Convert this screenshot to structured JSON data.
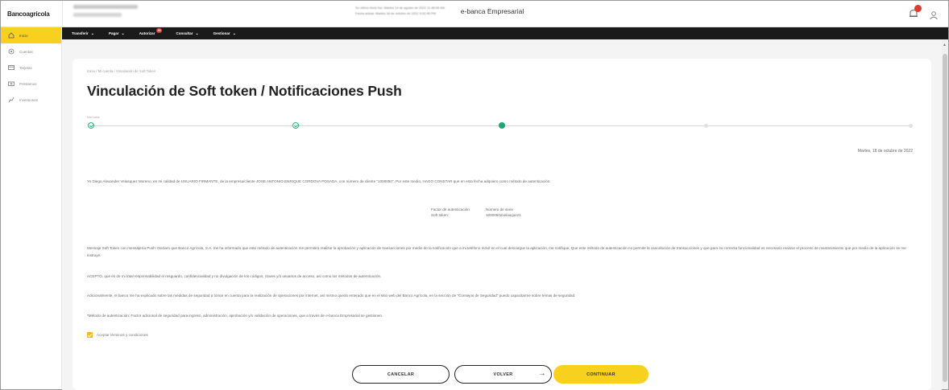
{
  "header": {
    "logo": "Bancoagrícola",
    "ebanca_label": "e-banca Empresarial",
    "session_line1": "Su último inicio fue: Martes 14 de agosto de 2022 11:48:06 AM",
    "session_line2": "Fecha actual: Martes 18 de octubre de 2022 9:02:46 PM",
    "notification_count": "1"
  },
  "menu": {
    "items": [
      {
        "label": "Transferir"
      },
      {
        "label": "Pagar"
      },
      {
        "label": "Autorizar",
        "badge": "25"
      },
      {
        "label": "Consultar"
      },
      {
        "label": "Gestionar"
      }
    ]
  },
  "sidebar": {
    "items": [
      {
        "label": "Inicio",
        "icon": "home-icon"
      },
      {
        "label": "Cuentas",
        "icon": "account-icon"
      },
      {
        "label": "Tarjetas",
        "icon": "card-icon"
      },
      {
        "label": "Préstamos",
        "icon": "loan-icon"
      },
      {
        "label": "Inversiones",
        "icon": "investment-icon"
      }
    ]
  },
  "breadcrumb": "Inicio  /  Mi cuenta  /  Vinculación de Soft Token",
  "title": "Vinculación de Soft token / Notificaciones Push",
  "stepper": {
    "label": "Mis Datos",
    "total_steps": 5,
    "current_step": 3
  },
  "date": "Martes, 18 de octubre de 2022",
  "paragraphs": {
    "intro": "Yo Diego Alexander Velasquez Moreno, en mi calidad de USUARIO FIRMANTE, de la empresa/cliente JOSE ANTONIO ENRIQUE CORDOVA POSADA, con número de cliente \"1000050\". Por este medio, HAGO CONSTAR que en esta fecha adquiero como método de autenticación:",
    "softtoken": "Mensaje Soft Token con mensajería Push: Declaro que Banco Agrícola, S.A. me ha informado que este método de autenticación me permitirá realizar la aprobación y aplicación de transacciones por medio de la notificación que a mi teléfono móvil en el cual descargue la aplicación, me notifique. Que este método de autenticación no permite la cancelación de transacciones y que para su correcta funcionalidad es necesario realizar el proceso de mantenimiento que por medio de la aplicación se me instruye.",
    "accept": "ACEPTO, que es de mi total responsabilidad el resguardo, confidencialidad y no divulgación de los códigos, claves y/o usuarios de acceso, así como los métodos de autenticación.",
    "additional": "Adicionalmente, el banco me ha explicado sobre las medidas de seguridad a tomar en cuenta para la realización de operaciones por internet, así mismo quedo enterado que en el sitio web del Banco Agrícola, en la sección de \"Consejos de Seguridad\" puedo capacitarme sobre temas de seguridad.",
    "definition": "*Método de autenticación: Factor adicional de seguridad para ingreso, administración, aprobación y/o validación de operaciones, que a través de e-banca Empresarial se gestionen."
  },
  "auth_table": {
    "col1_header": "Factor de autenticación",
    "col2_header": "Número de serie",
    "col1_value": "Soft token:",
    "col2_value": "1000050dvelasquez1"
  },
  "checkbox_label": "Aceptar términos y condiciones",
  "checkbox_checked": true,
  "buttons": {
    "cancel": "CANCELAR",
    "back": "VOLVER",
    "continue": "CONTINUAR"
  },
  "colors": {
    "brand_yellow": "#f7d11e",
    "step_green": "#1fa672",
    "menu_dark": "#1a1a1a"
  }
}
